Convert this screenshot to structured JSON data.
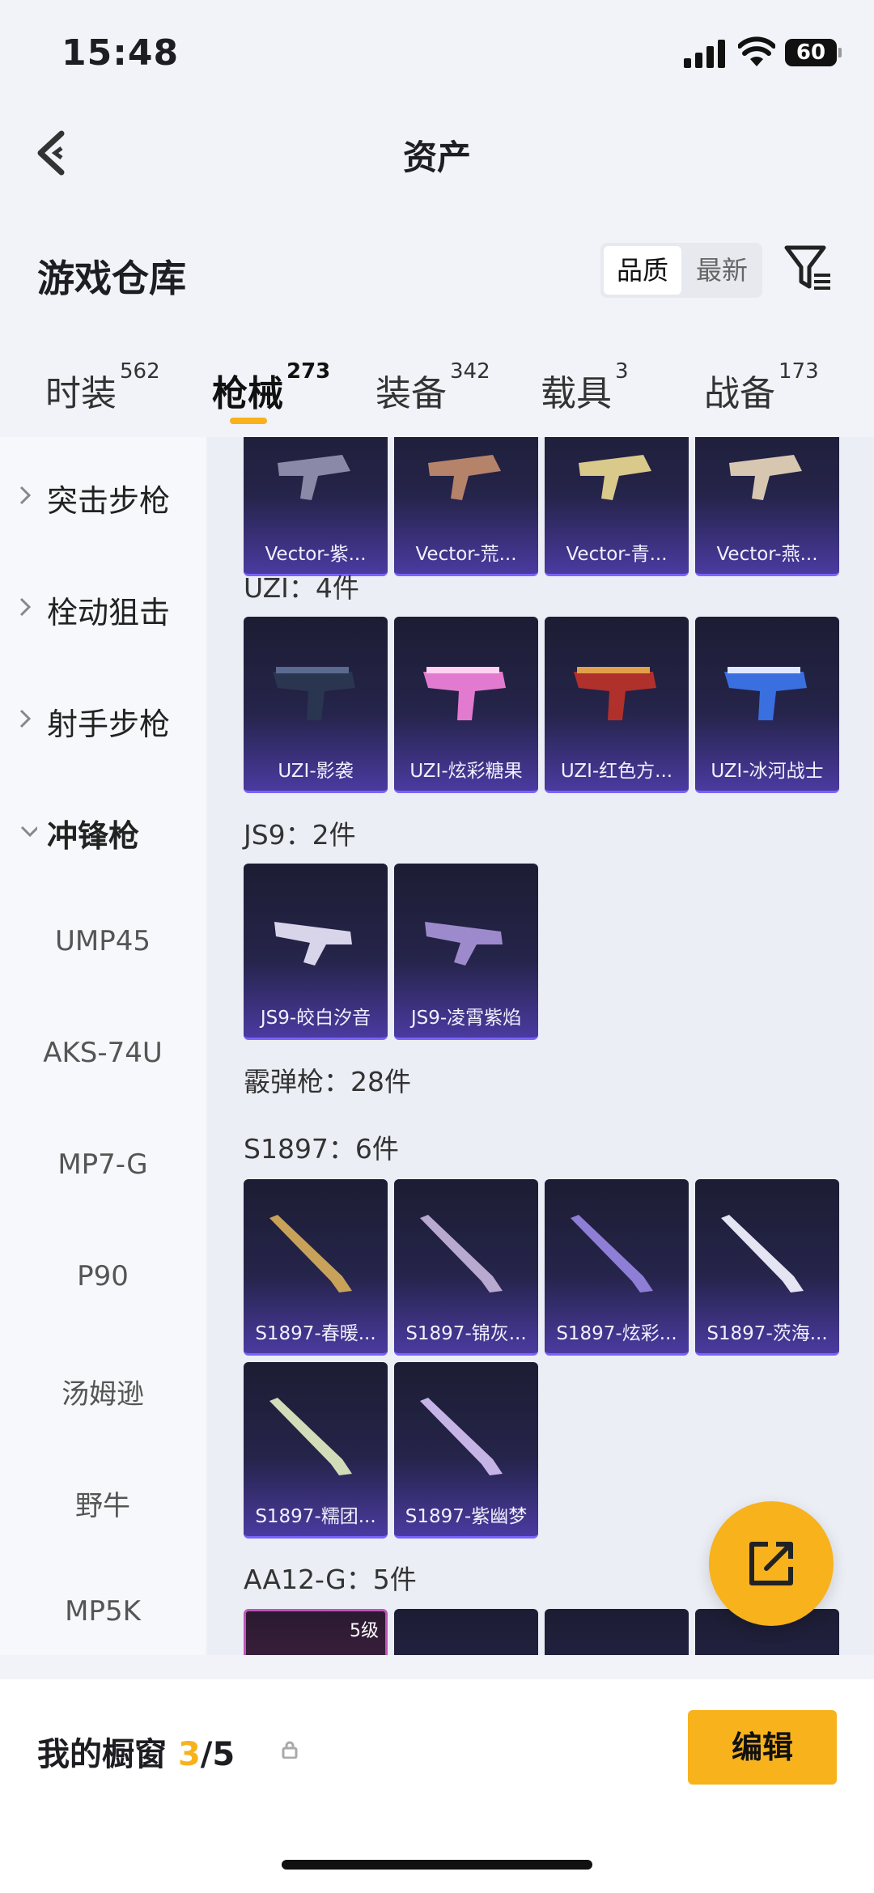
{
  "status": {
    "time": "15:48",
    "battery": "60"
  },
  "nav": {
    "title": "资产"
  },
  "header": {
    "title": "游戏仓库",
    "sort_active": "品质",
    "sort_inactive": "最新"
  },
  "tabs": [
    {
      "label": "时装",
      "count": "562"
    },
    {
      "label": "枪械",
      "count": "273"
    },
    {
      "label": "装备",
      "count": "342"
    },
    {
      "label": "载具",
      "count": "3"
    },
    {
      "label": "战备",
      "count": "173"
    }
  ],
  "sidebar": {
    "categories": [
      "突击步枪",
      "栓动狙击",
      "射手步枪",
      "冲锋枪"
    ],
    "sub": [
      "UMP45",
      "AKS-74U",
      "MP7-G",
      "P90",
      "汤姆逊",
      "野牛",
      "MP5K"
    ]
  },
  "sections": {
    "vector": {
      "cards": [
        "Vector-紫...",
        "Vector-荒...",
        "Vector-青...",
        "Vector-燕..."
      ]
    },
    "uzi": {
      "title": "UZI：4件",
      "cards": [
        "UZI-影袭",
        "UZI-炫彩糖果",
        "UZI-红色方...",
        "UZI-冰河战士"
      ]
    },
    "js9": {
      "title": "JS9：2件",
      "cards": [
        "JS9-皎白汐音",
        "JS9-凌霄紫焰"
      ]
    },
    "shotgun": {
      "title": "霰弹枪：28件"
    },
    "s1897": {
      "title": "S1897：6件",
      "cards": [
        "S1897-春暖...",
        "S1897-锦灰...",
        "S1897-炫彩...",
        "S1897-茨海...",
        "S1897-糯团...",
        "S1897-紫幽梦"
      ]
    },
    "aa12": {
      "title": "AA12-G：5件",
      "level": "5级"
    }
  },
  "bottom": {
    "label": "我的橱窗",
    "used": "3",
    "total": "/5",
    "edit": "编辑"
  },
  "colors": {
    "accent": "#f7b21c",
    "card_bg": "#25244a",
    "card_border": "#7a62ff"
  },
  "icons": [
    "back-icon",
    "filter-icon",
    "chevron-right-icon",
    "chevron-down-icon",
    "share-icon",
    "lock-icon"
  ]
}
